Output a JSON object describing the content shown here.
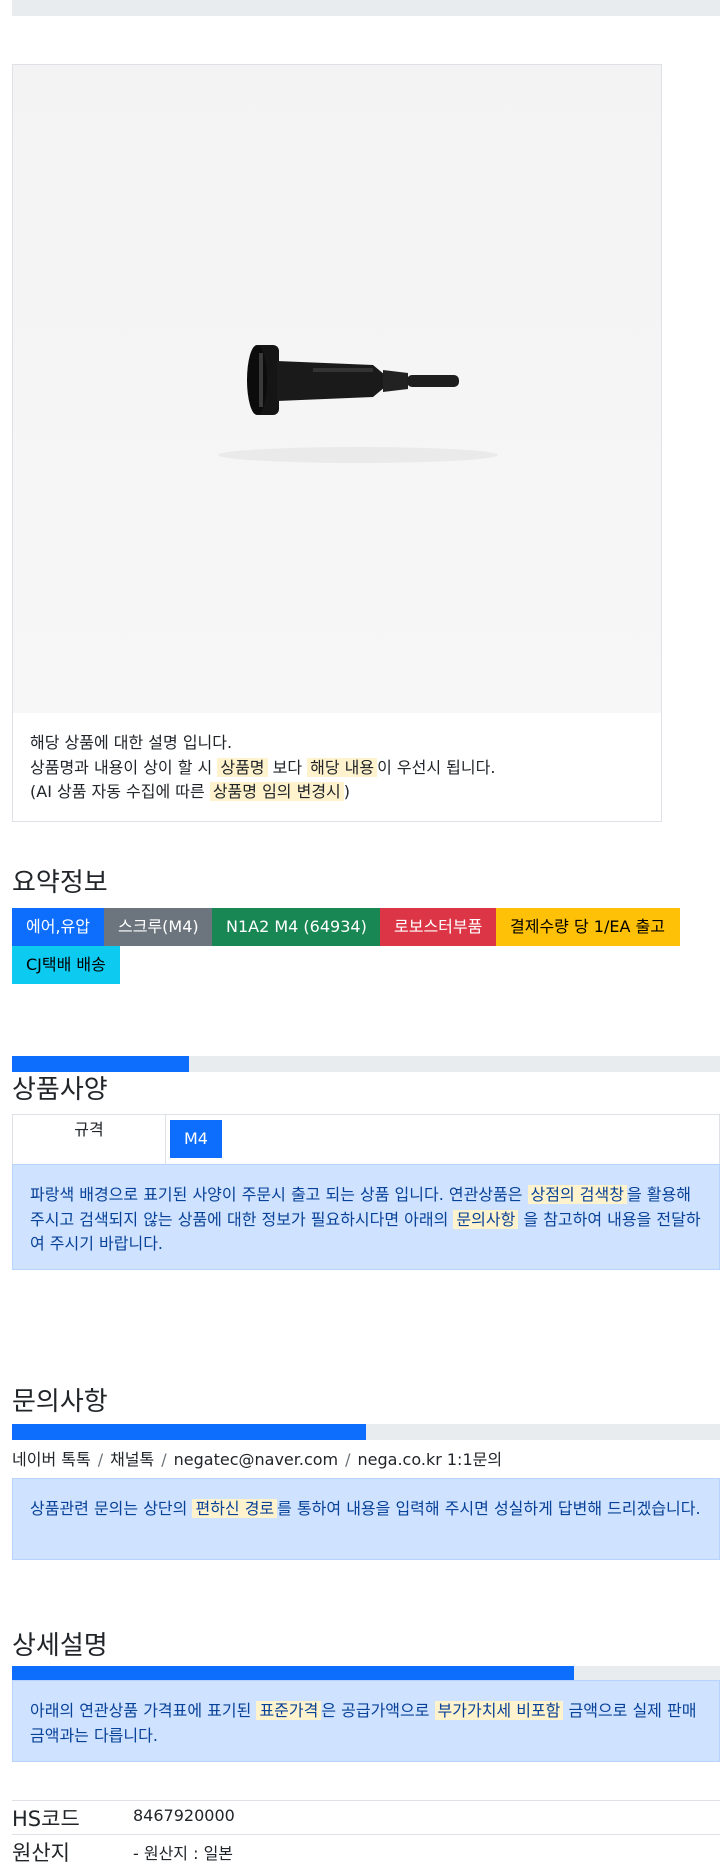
{
  "product_card": {
    "image_alt": "product-photo",
    "line1": "해당 상품에 대한 설명 입니다.",
    "line2_a": "상품명과 내용이 상이 할 시 ",
    "line2_hl1": "상품명",
    "line2_b": " 보다 ",
    "line2_hl2": "해당 내용",
    "line2_c": "이 우선시 됩니다.",
    "line3_a": "(AI 상품 자동 수집에 따른 ",
    "line3_hl": "상품명 임의 변경시",
    "line3_b": ")"
  },
  "summary": {
    "title": "요약정보",
    "badges": [
      "에어,유압",
      "스크루(M4)",
      "N1A2 M4 (64934)",
      "로보스터부품",
      "결제수량 당 1/EA 출고",
      "CJ택배 배송"
    ]
  },
  "spec": {
    "title": "상품사양",
    "progress_percent": 25,
    "label": "규격",
    "value": "M4",
    "notice_a": "파랑색 배경으로 표기된 사양이 주문시 출고 되는 상품 입니다. 연관상품은 ",
    "notice_hl1": "상점의 검색창",
    "notice_b": "을 활용해 주시고 검색되지 않는 상품에 대한 정보가 필요하시다면 아래의 ",
    "notice_hl2": "문의사항",
    "notice_c": " 을 참고하여 내용을 전달하여 주시기 바랍니다."
  },
  "inquiry": {
    "title": "문의사항",
    "progress_percent": 50,
    "channels": [
      "네이버 톡톡",
      "채널톡",
      "negatec@naver.com",
      "nega.co.kr 1:1문의"
    ],
    "notice_a": "상품관련 문의는 상단의 ",
    "notice_hl": "편하신 경로",
    "notice_b": "를 통하여 내용을 입력해 주시면 성실하게 답변해 드리겠습니다."
  },
  "detail": {
    "title": "상세설명",
    "progress_percent": 80,
    "notice_a": "아래의 연관상품 가격표에 표기된 ",
    "notice_hl1": "표준가격",
    "notice_b": "은 공급가액으로 ",
    "notice_hl2": "부가가치세 비포함",
    "notice_c": " 금액으로 실제 판매금액과는 다릅니다.",
    "hs_label": "HS코드",
    "hs_value": "8467920000",
    "origin_label": "원산지",
    "origin_value": "- 원산지 : 일본"
  },
  "colors": {
    "primary": "#0d6efd",
    "secondary": "#6c757d",
    "success": "#198754",
    "danger": "#dc3545",
    "warning": "#ffc107",
    "info": "#0dcaf0",
    "alert_bg": "#cfe2ff",
    "highlight": "#fff3cd"
  }
}
